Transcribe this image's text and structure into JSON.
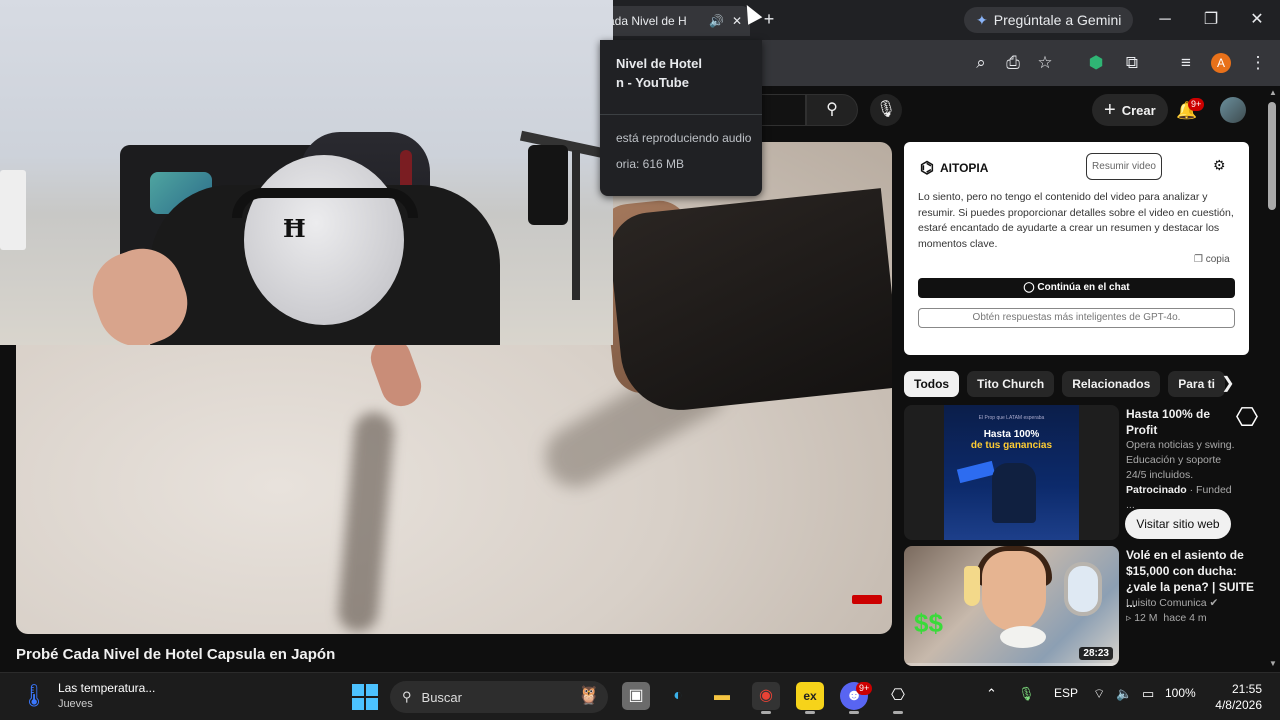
{
  "browser": {
    "tab_title": "ada Nivel de H",
    "gemini_label": "Pregúntale a Gemini",
    "profile_initial": "A",
    "hovercard": {
      "title_line1": "Nivel de Hotel",
      "title_line2": "n - YouTube",
      "audio_text": "está reproduciendo audio",
      "memory_text": "oria: 616 MB"
    }
  },
  "youtube": {
    "create_label": "Crear",
    "notifications_badge": "9+",
    "video_title": "Probé Cada Nivel de Hotel Capsula en Japón"
  },
  "aitopia": {
    "brand": "AITOPIA",
    "summary_button": "Resumir video",
    "message": "Lo siento, pero no tengo el contenido del video para analizar y resumir. Si puedes proporcionar detalles sobre el video en cuestión, estaré encantado de ayudarte a crear un resumen y destacar los momentos clave.",
    "copy_label": "copia",
    "chat_button": "Continúa en el chat",
    "gpt_button": "Obtén respuestas más inteligentes de GPT-4o."
  },
  "chips": [
    "Todos",
    "Tito Church",
    "Relacionados",
    "Para ti"
  ],
  "recommendations": {
    "ad": {
      "thumb_top": "El Prop que LATAM esperaba",
      "thumb_line1": "Hasta 100%",
      "thumb_line2": "de tus ganancias",
      "title_line1": "Hasta 100% de",
      "title_line2": "Profit",
      "desc_line1": "Opera noticias y swing.",
      "desc_line2": "Educación y soporte",
      "desc_line3": "24/5 incluidos.",
      "sponsored": "Patrocinado",
      "advertiser": "Funded ...",
      "visit_button": "Visitar sitio web"
    },
    "video": {
      "title_line1": "Volé en el asiento de",
      "title_line2": "$15,000 con ducha:",
      "title_line3": "¿vale la pena? | SUITE ...",
      "channel": "Luisito Comunica",
      "views": "12 M",
      "age": "hace 4 m",
      "duration": "28:23",
      "watched_fraction": 0.0
    }
  },
  "taskbar": {
    "weather_title": "Las temperatura...",
    "weather_sub": "Jueves",
    "search_label": "Buscar",
    "discord_badge": "9+",
    "language": "ESP",
    "battery": "100%",
    "time": "21:55",
    "date": "4/8/2026"
  }
}
